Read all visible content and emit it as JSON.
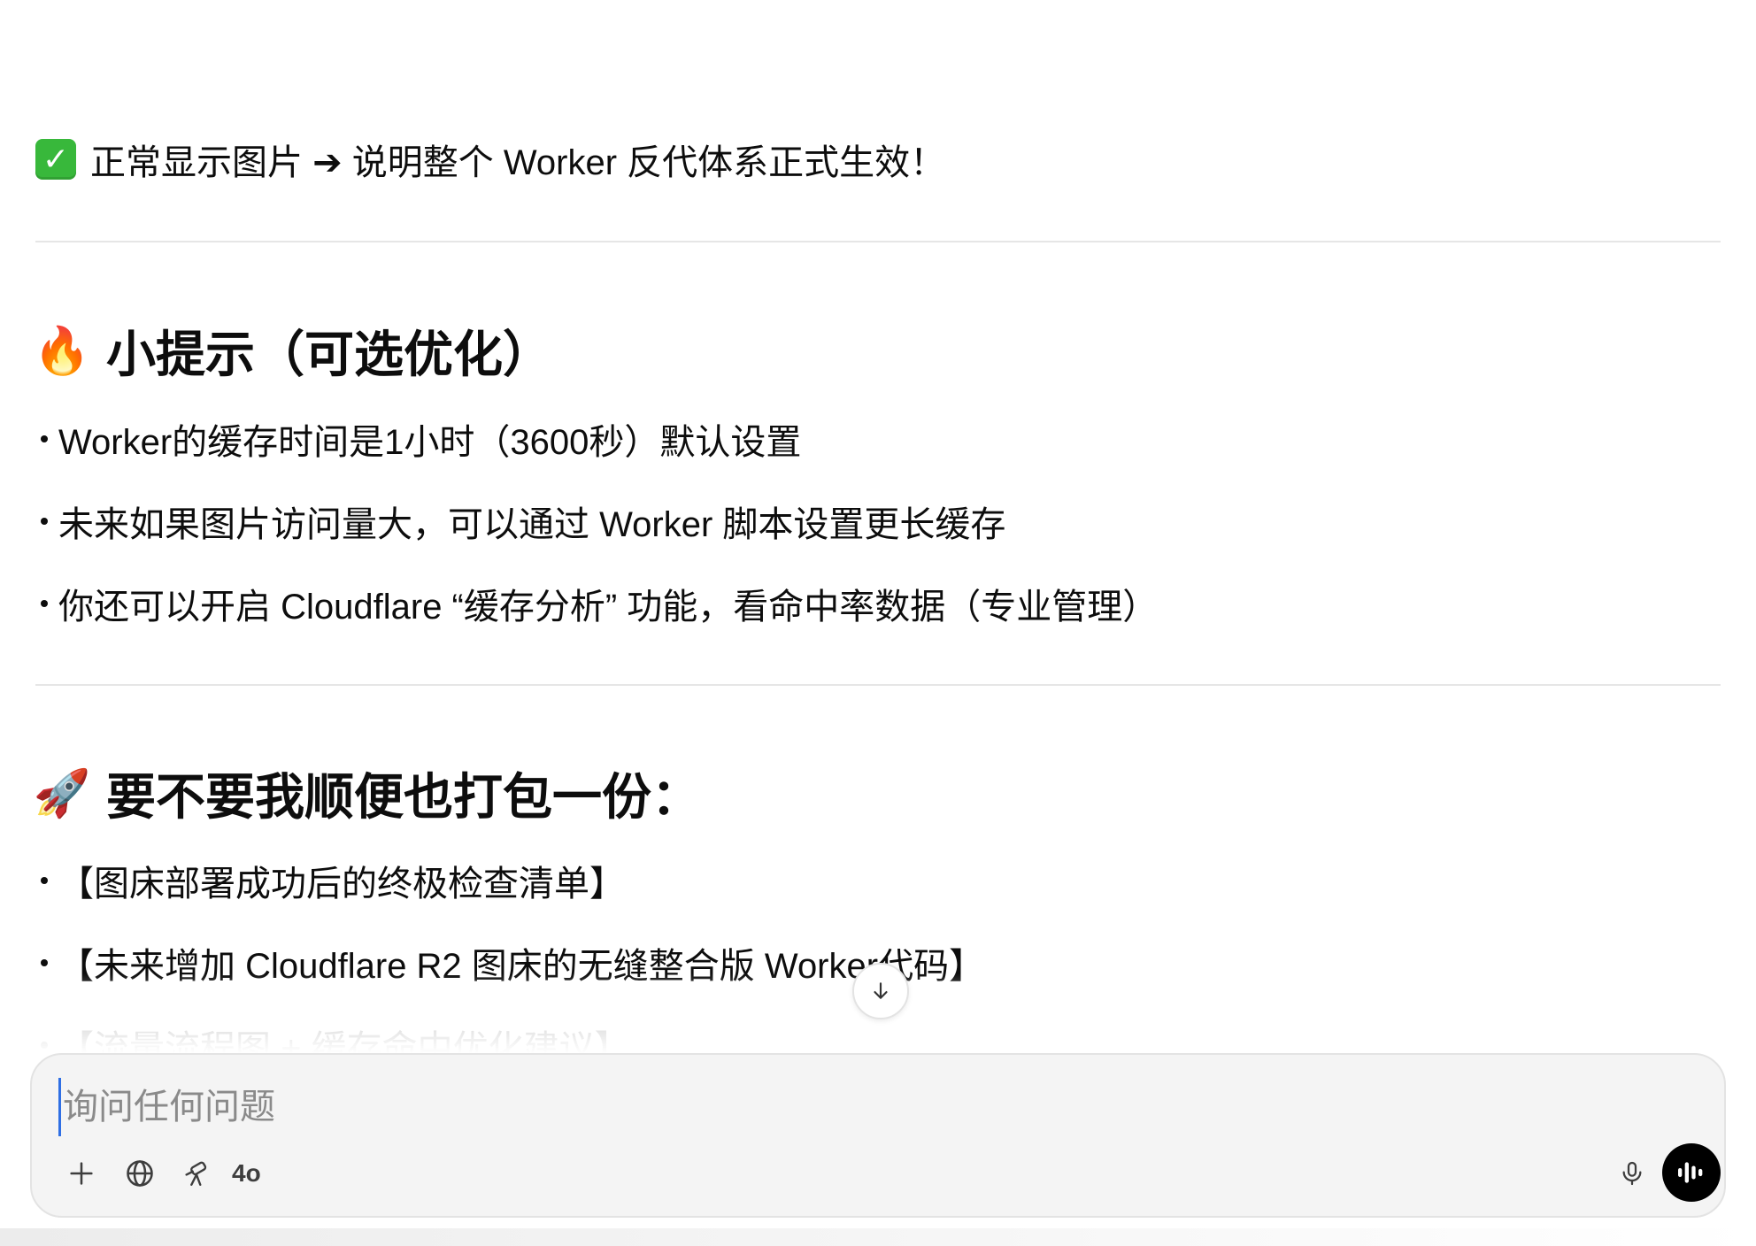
{
  "status_line": {
    "icon": "check-mark-emoji-icon",
    "text": "正常显示图片 ➔ 说明整个 Worker 反代体系正式生效！"
  },
  "tips": {
    "icon": "fire-emoji-icon",
    "heading": "小提示（可选优化）",
    "items": [
      {
        "label": "Worker的缓存时间是1小时（3600秒）默认设置"
      },
      {
        "label": "未来如果图片访问量大，可以通过 Worker 脚本设置更长缓存"
      },
      {
        "label": "你还可以开启 Cloudflare “缓存分析” 功能，看命中率数据（专业管理）"
      }
    ]
  },
  "offer": {
    "icon": "rocket-emoji-icon",
    "heading": "要不要我顺便也打包一份：",
    "items": [
      {
        "label": "【图床部署成功后的终极检查清单】"
      },
      {
        "label": "【未来增加 Cloudflare R2 图床的无缝整合版 Worker代码】"
      },
      {
        "label": "【流量流程图 + 缓存命中优化建议】"
      }
    ]
  },
  "composer": {
    "placeholder": "询问任何问题",
    "model_label": "4o",
    "icons": [
      "plus-icon",
      "globe-icon",
      "telescope-icon",
      "microphone-icon",
      "voice-waveform-icon"
    ]
  },
  "colors": {
    "check_green": "#38b83b",
    "text": "#0d0d0d",
    "composer_bg": "#f4f4f4",
    "voice_button": "#000000"
  }
}
